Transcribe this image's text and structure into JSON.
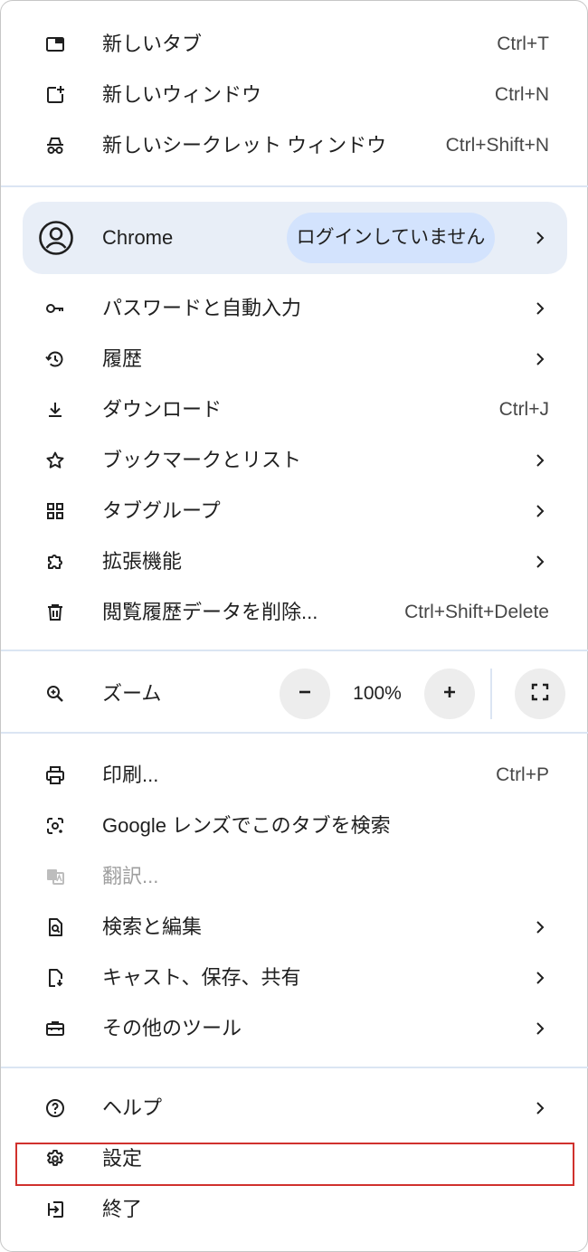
{
  "top_group": [
    {
      "label": "新しいタブ",
      "shortcut": "Ctrl+T",
      "icon": "new-tab-icon"
    },
    {
      "label": "新しいウィンドウ",
      "shortcut": "Ctrl+N",
      "icon": "new-window-icon"
    },
    {
      "label": "新しいシークレット ウィンドウ",
      "shortcut": "Ctrl+Shift+N",
      "icon": "incognito-icon"
    }
  ],
  "profile": {
    "name": "Chrome",
    "status": "ログインしていません",
    "icon": "account-circle-icon"
  },
  "middle_group": [
    {
      "label": "パスワードと自動入力",
      "icon": "key-icon",
      "submenu": true
    },
    {
      "label": "履歴",
      "icon": "history-icon",
      "submenu": true
    },
    {
      "label": "ダウンロード",
      "shortcut": "Ctrl+J",
      "icon": "download-icon"
    },
    {
      "label": "ブックマークとリスト",
      "icon": "star-icon",
      "submenu": true
    },
    {
      "label": "タブグループ",
      "icon": "tab-groups-icon",
      "submenu": true
    },
    {
      "label": "拡張機能",
      "icon": "extension-puzzle-icon",
      "submenu": true
    },
    {
      "label": "閲覧履歴データを削除...",
      "shortcut": "Ctrl+Shift+Delete",
      "icon": "trash-icon"
    }
  ],
  "zoom": {
    "label": "ズーム",
    "value": "100%",
    "minus_icon": "minus-icon",
    "plus_icon": "plus-icon",
    "fullscreen_icon": "fullscreen-icon"
  },
  "tools_group": [
    {
      "label": "印刷...",
      "shortcut": "Ctrl+P",
      "icon": "print-icon"
    },
    {
      "label": "Google レンズでこのタブを検索",
      "icon": "google-lens-icon"
    },
    {
      "label": "翻訳...",
      "icon": "translate-icon",
      "disabled": true
    },
    {
      "label": "検索と編集",
      "icon": "find-in-page-icon",
      "submenu": true
    },
    {
      "label": "キャスト、保存、共有",
      "icon": "cast-save-share-icon",
      "submenu": true
    },
    {
      "label": "その他のツール",
      "icon": "toolbox-icon",
      "submenu": true
    }
  ],
  "bottom_group": [
    {
      "label": "ヘルプ",
      "icon": "help-icon",
      "submenu": true
    },
    {
      "label": "設定",
      "icon": "gear-icon",
      "highlighted": true
    },
    {
      "label": "終了",
      "icon": "exit-icon"
    }
  ],
  "colors": {
    "text": "#1f1f1f",
    "secondary_text": "#474747",
    "disabled_text": "#9e9e9e",
    "profile_bg": "#e8eef7",
    "signin_chip_bg": "#d3e3fd",
    "divider": "#dbe5f3",
    "zoom_button_bg": "#ededed",
    "highlight_border": "#d0312d"
  }
}
